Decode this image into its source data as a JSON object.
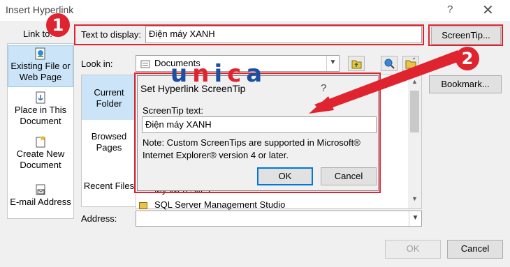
{
  "dialog": {
    "title": "Insert Hyperlink",
    "help": "?",
    "close": "✕",
    "link_to": "Link to:",
    "text_to_display_label": "Text to display:",
    "text_to_display_value": "Điện máy XANH",
    "screentip_button": "ScreenTip...",
    "look_in_label": "Look in:",
    "look_in_value": "Documents",
    "bookmark_button": "Bookmark...",
    "address_label": "Address:",
    "address_value": "",
    "ok_button": "OK",
    "cancel_button": "Cancel"
  },
  "nav": [
    {
      "label": "Existing File or Web Page"
    },
    {
      "label": "Place in This Document"
    },
    {
      "label": "Create New Document"
    },
    {
      "label": "E-mail Address"
    }
  ],
  "inner_nav": [
    {
      "label": "Current Folder"
    },
    {
      "label": "Browsed Pages"
    },
    {
      "label": "Recent Files"
    }
  ],
  "files": [
    "My Web Sites",
    "SQL Server Management Studio"
  ],
  "popup": {
    "title": "Set Hyperlink ScreenTip",
    "help": "?",
    "screentip_label": "ScreenTip text:",
    "screentip_value": "Điện máy XANH",
    "note": "Note: Custom ScreenTips are supported in Microsoft® Internet Explorer® version 4 or later.",
    "ok_button": "OK",
    "cancel_button": "Cancel"
  },
  "overlay": {
    "watermark": "unica",
    "badge_1": "1",
    "badge_2": "2"
  },
  "colors": {
    "annotation_red": "#e0242f",
    "selection_blue": "#cce4f7",
    "accent_blue": "#0078d7"
  }
}
